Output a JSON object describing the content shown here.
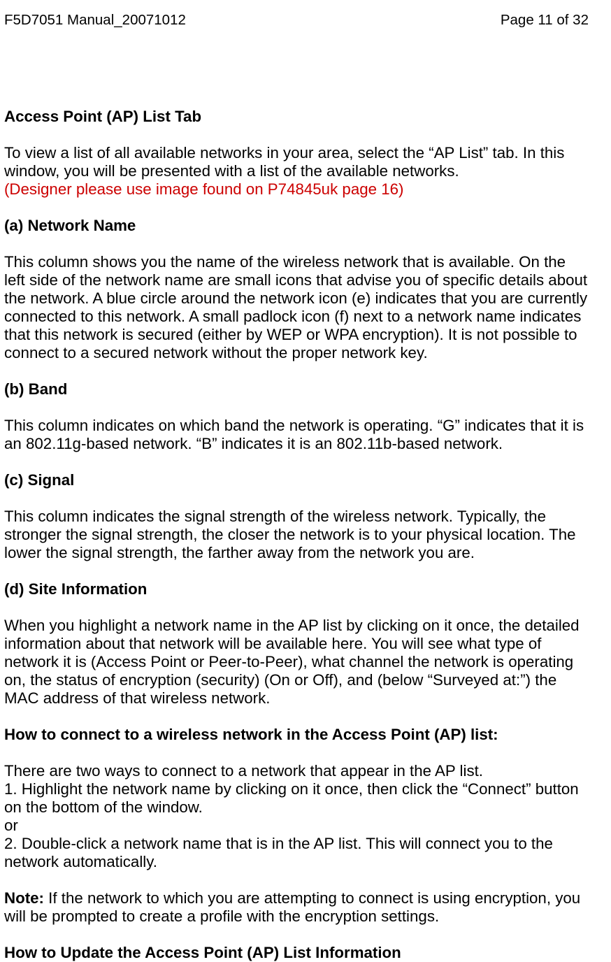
{
  "header": {
    "left": "F5D7051 Manual_20071012",
    "right": "Page 11 of 32"
  },
  "sections": {
    "ap_list_tab": {
      "title": "Access Point (AP) List Tab",
      "body": "To view a list of all available networks in your area, select the “AP List” tab. In this window, you will be presented with a list of the available networks.",
      "designer_note": "(Designer please use image found on P74845uk page 16)"
    },
    "network_name": {
      "title": "(a) Network Name",
      "body": "This column shows you the name of the wireless network that is available. On the left side of the network name are small icons that advise you of specific details about the network. A blue circle around the network icon (e) indicates that you are currently connected to this network. A small padlock icon (f) next to a network name indicates that this network is secured (either by WEP or WPA encryption). It is not possible to connect to a secured network without the proper network key."
    },
    "band": {
      "title": "(b) Band",
      "body": "This column indicates on which band the network is operating. “G” indicates that it is an 802.11g-based network. “B” indicates it is an 802.11b-based network."
    },
    "signal": {
      "title": "(c) Signal",
      "body": "This column indicates the signal strength of the wireless network. Typically, the stronger the signal strength, the closer the network is to your physical location. The lower the signal strength, the farther away from the network you are."
    },
    "site_info": {
      "title": "(d) Site Information",
      "body": "When you highlight a network name in the AP list by clicking on it once, the detailed information about that network will be available here. You will see what type of network it is (Access Point or Peer-to-Peer), what channel the network is operating on, the status of encryption (security) (On or Off), and (below “Surveyed at:”) the MAC address of that wireless network."
    },
    "how_connect": {
      "title": "How to connect to a wireless network in the Access Point (AP) list:",
      "intro": "There are two ways to connect to a network that appear in the AP list.",
      "step1": "1. Highlight the network name by clicking on it once, then click the “Connect” button on the bottom of the window.",
      "or": "or",
      "step2": "2. Double-click a network name that is in the AP list. This will connect you to the network automatically."
    },
    "note": {
      "label": "Note: ",
      "body": "If the network to which you are attempting to connect is using encryption, you will be prompted to create a profile with the encryption settings."
    },
    "how_update": {
      "title": "How to Update the Access Point (AP) List Information"
    }
  }
}
